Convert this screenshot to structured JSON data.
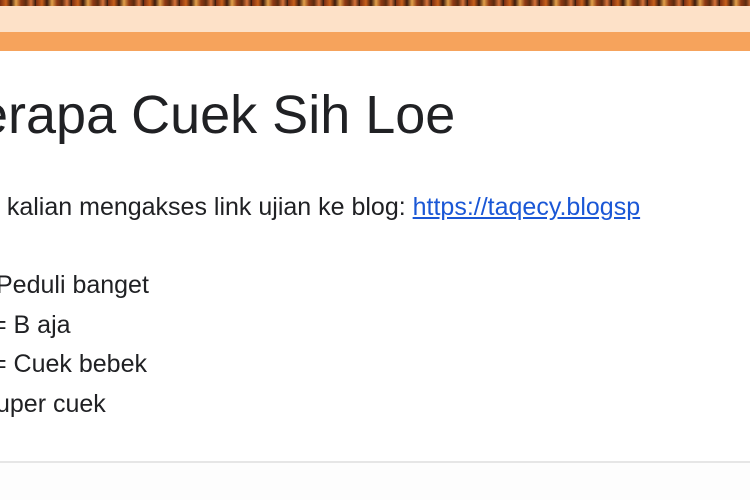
{
  "form": {
    "title": "erapa Cuek Sih Loe",
    "description_prefix": "n kalian mengakses link ujian ke blog: ",
    "description_link": "https://taqecy.blogsp"
  },
  "options": [
    "Peduli banget",
    "= B aja",
    "= Cuek bebek",
    "uper cuek"
  ],
  "colors": {
    "accent": "#f6a35c",
    "header_bg": "#fde1c8",
    "link": "#1a57d6",
    "text": "#202124"
  }
}
